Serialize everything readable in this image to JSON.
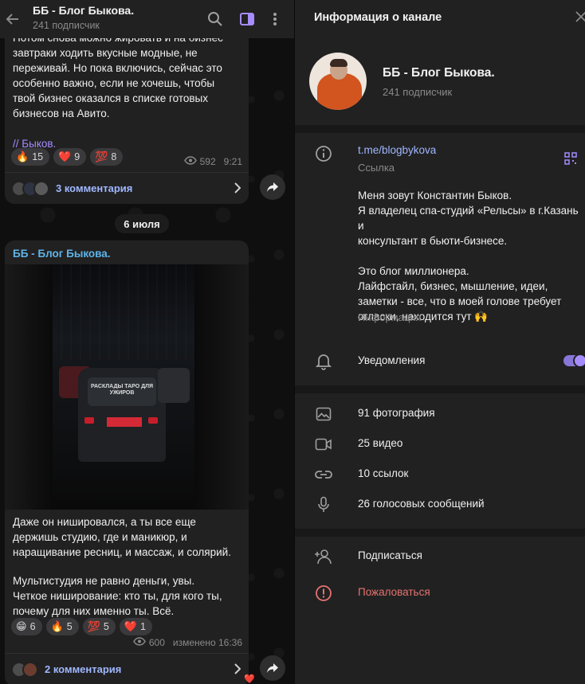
{
  "chat": {
    "title": "ББ - Блог Быкова.",
    "subtitle": "241 подписчик",
    "post1": {
      "text_lines": [
        "Потом снова можно жировать и на бизнес",
        "завтраки ходить вкусные модные, не",
        "переживай. Но пока включись, сейчас это",
        "особенно важно, если не хочешь, чтобы",
        "твой бизнес оказался в списке готовых",
        "бизнесов на Авито."
      ],
      "signature": "// Быков.",
      "reactions": [
        {
          "emoji": "🔥",
          "count": "15"
        },
        {
          "emoji": "❤️",
          "count": "9"
        },
        {
          "emoji": "💯",
          "count": "8"
        }
      ],
      "views": "592",
      "time": "9:21",
      "comments_label": "3 комментария"
    },
    "date_divider": "6 июля",
    "post2": {
      "author": "ББ - Блог Быкова.",
      "image_caption_text": "РАСКЛАДЫ ТАРО ДЛЯ УЖИРОВ",
      "text_lines_a": [
        "Даже он нишировался, а ты все еще",
        "держишь студию, где и маникюр, и",
        "наращивание ресниц, и массаж, и солярий."
      ],
      "text_lines_b": [
        "Мультистудия не равно деньги, увы.",
        "Четкое ниширование: кто ты, для кого ты,",
        "почему для них именно ты. Всё."
      ],
      "reactions": [
        {
          "emoji": "😁",
          "count": "6"
        },
        {
          "emoji": "🔥",
          "count": "5"
        },
        {
          "emoji": "💯",
          "count": "5"
        },
        {
          "emoji": "❤️",
          "count": "1"
        }
      ],
      "views": "600",
      "time": "изменено 16:36",
      "comments_label": "2 комментария"
    }
  },
  "info": {
    "header_title": "Информация о канале",
    "channel_name": "ББ - Блог Быкова.",
    "channel_subs": "241 подписчик",
    "link": "t.me/blogbykova",
    "link_caption": "Ссылка",
    "about_lines_a": [
      "Меня зовут Константин Быков.",
      "Я владелец спа-студий «Рельсы» в г.Казань и",
      "консультант в бьюти-бизнесе."
    ],
    "about_lines_b": [
      "Это блог миллионера.",
      "Лайфстайл, бизнес, мышление, идеи,",
      "заметки - все, что в моей голове требует",
      "огласки, находится тут 🙌"
    ],
    "about_caption": "Информация",
    "notifications_label": "Уведомления",
    "notifications_on": true,
    "media": [
      {
        "icon": "photo-icon",
        "label": "91 фотография"
      },
      {
        "icon": "video-icon",
        "label": "25 видео"
      },
      {
        "icon": "link-icon",
        "label": "10 ссылок"
      },
      {
        "icon": "microphone-icon",
        "label": "26 голосовых сообщений"
      }
    ],
    "subscribe_label": "Подписаться",
    "report_label": "Пожаловаться"
  },
  "colors": {
    "accent": "#9b8cff",
    "danger": "#e5736f",
    "link": "#9fb7ff"
  }
}
